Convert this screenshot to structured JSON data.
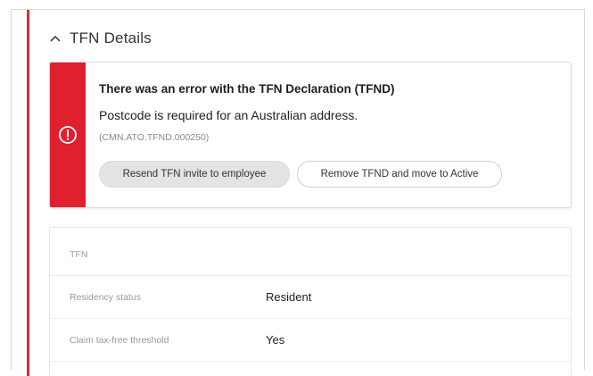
{
  "section": {
    "title": "TFN Details"
  },
  "error": {
    "title": "There was an error with the TFN Declaration (TFND)",
    "message": "Postcode is required for an Australian address.",
    "code": "(CMN.ATO.TFND.000250)",
    "resend_label": "Resend TFN invite to employee",
    "remove_label": "Remove TFND and move to Active",
    "icon": "alert-circle-icon",
    "accent_color": "#e0202f"
  },
  "details": {
    "rows": [
      {
        "label": "TFN",
        "value": ""
      },
      {
        "label": "Residency status",
        "value": "Resident"
      },
      {
        "label": "Claim tax-free threshold",
        "value": "Yes"
      }
    ]
  }
}
